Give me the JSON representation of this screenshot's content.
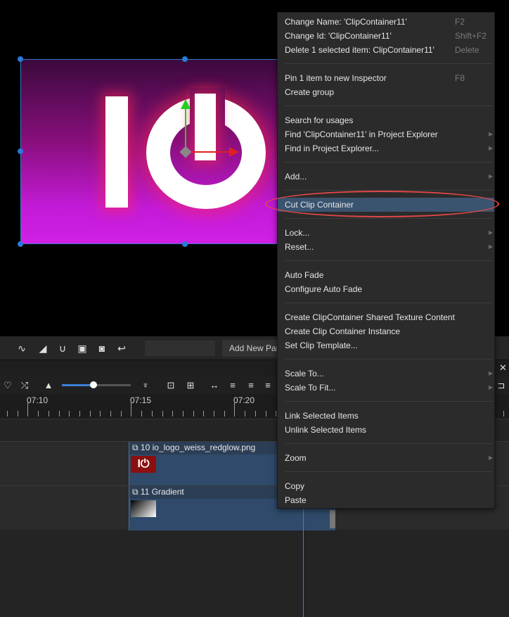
{
  "context_menu": {
    "groups": [
      [
        {
          "label": "Change Name: 'ClipContainer11'",
          "shortcut": "F2"
        },
        {
          "label": "Change Id: 'ClipContainer11'",
          "shortcut": "Shift+F2"
        },
        {
          "label": "Delete 1 selected item: ClipContainer11'",
          "shortcut": "Delete"
        }
      ],
      [
        {
          "label": "Pin 1 item to new Inspector",
          "shortcut": "F8"
        },
        {
          "label": "Create group",
          "shortcut": ""
        }
      ],
      [
        {
          "label": "Search for usages",
          "shortcut": ""
        },
        {
          "label": "Find 'ClipContainer11' in Project Explorer",
          "submenu": true
        },
        {
          "label": "Find in Project Explorer...",
          "submenu": true
        }
      ],
      [
        {
          "label": "Add...",
          "submenu": true
        }
      ],
      [
        {
          "label": "Cut Clip Container",
          "highlighted": true
        }
      ],
      [
        {
          "label": "Lock...",
          "submenu": true
        },
        {
          "label": "Reset...",
          "submenu": true
        }
      ],
      [
        {
          "label": "Auto Fade"
        },
        {
          "label": "Configure Auto Fade"
        }
      ],
      [
        {
          "label": "Create ClipContainer Shared Texture Content"
        },
        {
          "label": "Create Clip Container Instance"
        },
        {
          "label": "Set Clip Template..."
        }
      ],
      [
        {
          "label": "Scale To...",
          "submenu": true
        },
        {
          "label": "Scale To Fit...",
          "submenu": true
        }
      ],
      [
        {
          "label": "Link Selected Items"
        },
        {
          "label": "Unlink Selected Items"
        }
      ],
      [
        {
          "label": "Zoom",
          "submenu": true
        }
      ],
      [
        {
          "label": "Copy"
        },
        {
          "label": "Paste"
        }
      ]
    ]
  },
  "toolbar": {
    "add_new_label": "Add New Par",
    "icons": [
      "waveform-icon",
      "ramp-icon",
      "magnet-icon",
      "fit-icon",
      "camera-icon",
      "undo-icon"
    ]
  },
  "timeline": {
    "ruler_labels": [
      "07:10",
      "07:15",
      "07:20"
    ],
    "tracks": [
      {
        "title": "10 io_logo_weiss_redglow.png"
      },
      {
        "title": "11 Gradient"
      }
    ]
  },
  "colors": {
    "accent": "#3a536f",
    "highlight_ring": "#e04848",
    "selection": "#2a7ad8"
  }
}
